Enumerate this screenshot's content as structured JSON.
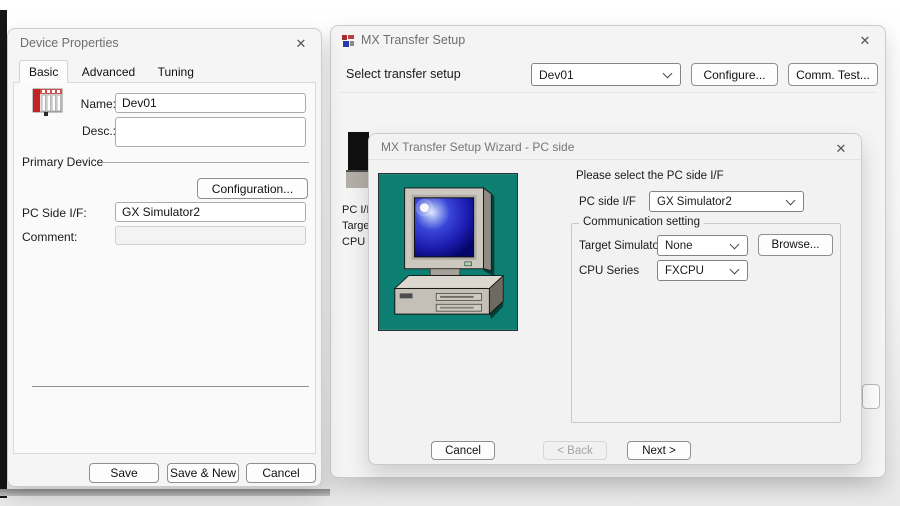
{
  "icons": {
    "close": "✕"
  },
  "colors": {
    "teal_background": "#0c7f72",
    "screen_blue": "#2222bb",
    "device_icon_red": "#c42222",
    "title_gray": "#6e6e6e"
  },
  "device_properties": {
    "title": "Device Properties",
    "tabs": [
      "Basic",
      "Advanced",
      "Tuning"
    ],
    "name_label": "Name:",
    "name_value": "Dev01",
    "desc_label": "Desc.:",
    "desc_value": "",
    "primary_device_label": "Primary Device",
    "configuration_button": "Configuration...",
    "pc_side_label": "PC Side I/F:",
    "pc_side_value": "GX Simulator2",
    "comment_label": "Comment:",
    "comment_value": "",
    "save_button": "Save",
    "save_new_button": "Save & New",
    "cancel_button": "Cancel"
  },
  "transfer_setup": {
    "title": "MX Transfer Setup",
    "select_label": "Select transfer setup",
    "device_dropdown_value": "Dev01",
    "configure_button": "Configure...",
    "comm_test_button": "Comm. Test...",
    "obscured_labels": [
      "PC I/F",
      "Target",
      "CPU S"
    ]
  },
  "wizard": {
    "title": "MX Transfer Setup Wizard - PC side",
    "prompt": "Please select the PC side I/F",
    "pc_side_label": "PC side I/F",
    "pc_side_value": "GX Simulator2",
    "group_label": "Communication setting",
    "target_label": "Target Simulator",
    "target_value": "None",
    "browse_button": "Browse...",
    "cpu_label": "CPU Series",
    "cpu_value": "FXCPU",
    "cancel_button": "Cancel",
    "back_button": "< Back",
    "next_button": "Next >"
  }
}
